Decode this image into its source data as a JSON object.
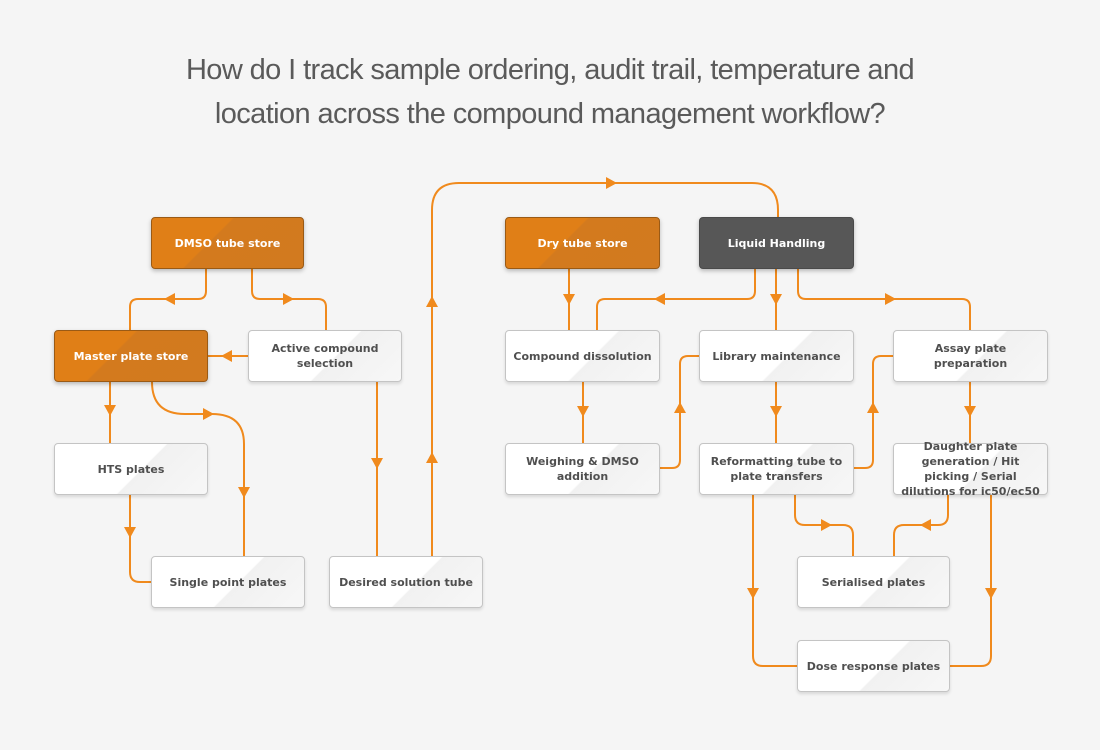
{
  "title": {
    "line1": "How do I track sample ordering, audit trail, temperature and",
    "line2": "location across the compound management workflow?"
  },
  "colors": {
    "background": "#f5f5f5",
    "connector": "#f08a1d",
    "store_node": "#e07f17",
    "handling_node": "#575757",
    "process_node": "#ffffff",
    "title_text": "#5a5a5a"
  },
  "nodes": {
    "dmso_tube_store": "DMSO tube store",
    "master_plate_store": "Master plate store",
    "active_compound_selection": "Active compound selection",
    "hts_plates": "HTS plates",
    "single_point_plates": "Single point plates",
    "desired_solution_tube": "Desired solution tube",
    "dry_tube_store": "Dry tube store",
    "liquid_handling": "Liquid Handling",
    "compound_dissolution": "Compound dissolution",
    "weighing_dmso_addition": "Weighing & DMSO addition",
    "library_maintenance": "Library maintenance",
    "reformatting_tube_to_plate": "Reformatting tube to plate transfers",
    "assay_plate_preparation": "Assay plate preparation",
    "daughter_plate_generation": "Daughter plate generation / Hit picking / Serial dilutions for ic50/ec50",
    "serialised_plates": "Serialised plates",
    "dose_response_plates": "Dose response plates"
  },
  "edges": [
    {
      "from": "DMSO tube store",
      "to": "Master plate store"
    },
    {
      "from": "DMSO tube store",
      "to": "Active compound selection"
    },
    {
      "from": "Active compound selection",
      "to": "Master plate store"
    },
    {
      "from": "Active compound selection",
      "to": "Desired solution tube"
    },
    {
      "from": "Master plate store",
      "to": "HTS plates"
    },
    {
      "from": "Master plate store",
      "to": "Single point plates"
    },
    {
      "from": "HTS plates",
      "to": "Single point plates"
    },
    {
      "from": "Desired solution tube",
      "to": "Liquid Handling"
    },
    {
      "from": "Dry tube store",
      "to": "Compound dissolution"
    },
    {
      "from": "Liquid Handling",
      "to": "Compound dissolution"
    },
    {
      "from": "Liquid Handling",
      "to": "Library maintenance"
    },
    {
      "from": "Liquid Handling",
      "to": "Assay plate preparation"
    },
    {
      "from": "Compound dissolution",
      "to": "Weighing & DMSO addition"
    },
    {
      "from": "Weighing & DMSO addition",
      "to": "Library maintenance"
    },
    {
      "from": "Library maintenance",
      "to": "Reformatting tube to plate transfers"
    },
    {
      "from": "Reformatting tube to plate transfers",
      "to": "Assay plate preparation"
    },
    {
      "from": "Assay plate preparation",
      "to": "Daughter plate generation / Hit picking / Serial dilutions for ic50/ec50"
    },
    {
      "from": "Reformatting tube to plate transfers",
      "to": "Serialised plates"
    },
    {
      "from": "Daughter plate generation / Hit picking / Serial dilutions for ic50/ec50",
      "to": "Serialised plates"
    },
    {
      "from": "Reformatting tube to plate transfers",
      "to": "Dose response plates"
    },
    {
      "from": "Daughter plate generation / Hit picking / Serial dilutions for ic50/ec50",
      "to": "Dose response plates"
    }
  ]
}
